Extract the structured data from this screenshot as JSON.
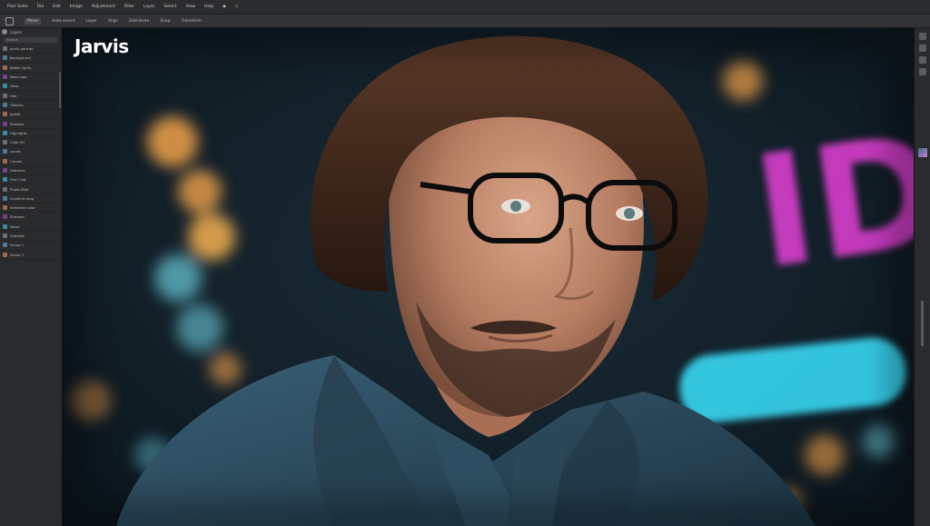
{
  "menubar": {
    "items": [
      "Pixlr Suite",
      "File",
      "Edit",
      "Image",
      "Adjustment",
      "Filter",
      "Layer",
      "Select",
      "View",
      "Help",
      "◆",
      "◇"
    ]
  },
  "optbar": {
    "items": [
      "Move",
      "Auto select",
      "Layer",
      "Align",
      "Distribute",
      "Snap",
      "Transform"
    ]
  },
  "leftpanel": {
    "title": "Layers",
    "search_placeholder": "Search",
    "layers": [
      "Jarvis portrait",
      "Background",
      "Bokeh lights",
      "Neon sign",
      "Glow",
      "Hair",
      "Glasses",
      "Jacket",
      "Shadow",
      "Highlights",
      "Color fill",
      "Levels",
      "Curves",
      "Vibrance",
      "Hue / Sat",
      "Photo filter",
      "Gradient map",
      "Selective color",
      "Sharpen",
      "Noise",
      "Vignette",
      "Group 1",
      "Group 2"
    ]
  },
  "canvas": {
    "watermark": "Jarvis",
    "neon_text": "IDS",
    "colors": {
      "background": "#0e1a22",
      "neon_pink": "#e43fd6",
      "neon_cyan": "#37d6f2",
      "bokeh_orange": "#f2a24a",
      "bokeh_teal": "#6fd8e8",
      "jacket": "#2c4a5c",
      "hair": "#3a2418",
      "skin": "#c08a6e"
    }
  },
  "rightstrip": {
    "icons": [
      "history-icon",
      "adjust-icon",
      "properties-icon",
      "layers-icon"
    ]
  }
}
